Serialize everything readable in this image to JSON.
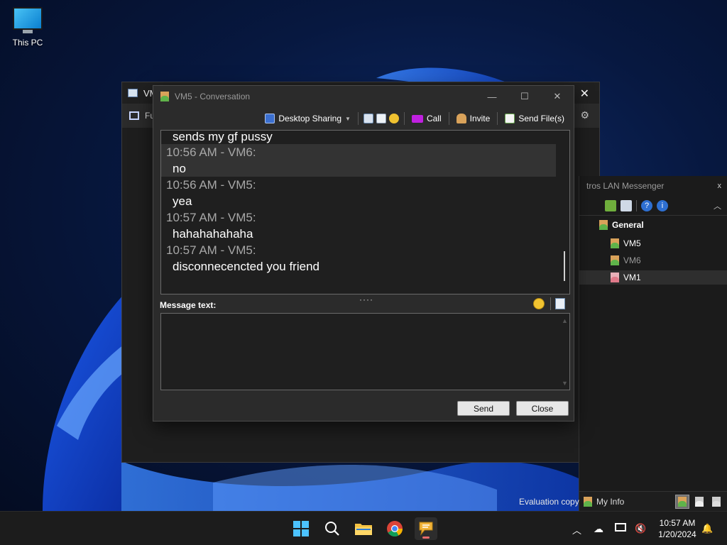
{
  "desktop": {
    "icon_label": "This PC"
  },
  "back_window": {
    "title": "VM",
    "toolbar_text": "Fu"
  },
  "conversation": {
    "title": "VM5 - Conversation",
    "toolbar": {
      "desktop_sharing": "Desktop Sharing",
      "call": "Call",
      "invite": "Invite",
      "send_files": "Send File(s)"
    },
    "messages": [
      {
        "type": "text",
        "text": "sends my gf pussy"
      },
      {
        "type": "meta",
        "text": "10:56 AM - VM6:"
      },
      {
        "type": "text",
        "text": "no"
      },
      {
        "type": "meta",
        "text": "10:56 AM - VM5:"
      },
      {
        "type": "text",
        "text": "yea"
      },
      {
        "type": "meta",
        "text": "10:57 AM - VM5:"
      },
      {
        "type": "text",
        "text": "hahahahahaha"
      },
      {
        "type": "meta",
        "text": "10:57 AM - VM5:"
      },
      {
        "type": "text",
        "text": "disconnecencted you friend"
      }
    ],
    "message_label": "Message text:",
    "message_value": "",
    "send_label": "Send",
    "close_label": "Close"
  },
  "messenger": {
    "title": "tros LAN Messenger",
    "group": "General",
    "users": [
      {
        "name": "VM5",
        "color": "#ffffff",
        "status_color": "#5fb34a"
      },
      {
        "name": "VM6",
        "color": "#9a9a9a",
        "status_color": "#5fb34a"
      },
      {
        "name": "VM1",
        "color": "#ffffff",
        "status_color": "#e07a8a"
      }
    ],
    "my_info": "My Info",
    "evaluation": "Evaluation copy"
  },
  "taskbar": {
    "time": "10:57 AM",
    "date": "1/20/2024"
  }
}
